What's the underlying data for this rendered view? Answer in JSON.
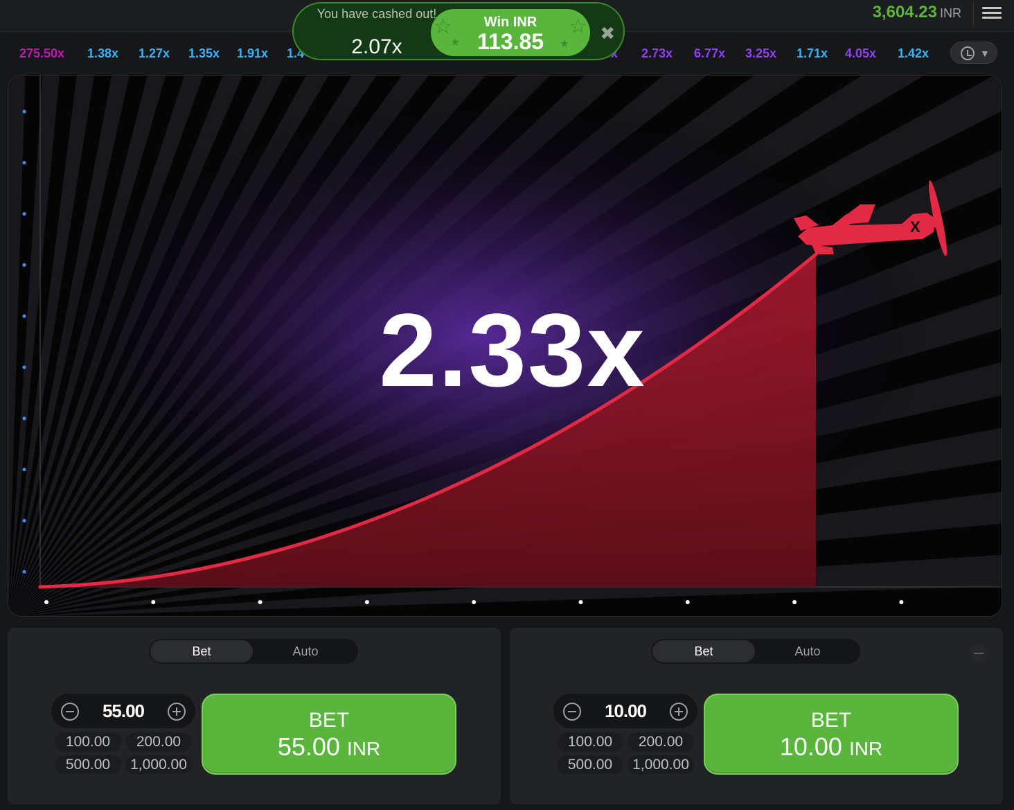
{
  "topbar": {
    "balance": "3,604.23",
    "currency": "INR"
  },
  "history": [
    {
      "value": "275.50x",
      "color": "#c017b4"
    },
    {
      "value": "1.38x",
      "color": "#34b4ff"
    },
    {
      "value": "1.27x",
      "color": "#34b4ff"
    },
    {
      "value": "1.35x",
      "color": "#34b4ff"
    },
    {
      "value": "1.91x",
      "color": "#34b4ff"
    },
    {
      "value": "1.4",
      "color": "#34b4ff"
    },
    {
      "value": "x",
      "color": "#913ef8"
    },
    {
      "value": "2.73x",
      "color": "#913ef8"
    },
    {
      "value": "6.77x",
      "color": "#913ef8"
    },
    {
      "value": "3.25x",
      "color": "#913ef8"
    },
    {
      "value": "1.71x",
      "color": "#34b4ff"
    },
    {
      "value": "4.05x",
      "color": "#913ef8"
    },
    {
      "value": "1.42x",
      "color": "#34b4ff"
    }
  ],
  "toast": {
    "message": "You have cashed out!",
    "multiplier": "2.07x",
    "win_label": "Win INR",
    "win_amount": "113.85"
  },
  "game": {
    "multiplier": "2.33x",
    "curve_color": "#e32a45",
    "plane_color": "#e32a45"
  },
  "panels": [
    {
      "tabs": [
        "Bet",
        "Auto"
      ],
      "amount": "55.00",
      "quick": [
        "100.00",
        "200.00",
        "500.00",
        "1,000.00"
      ],
      "bet_label": "BET",
      "bet_amount": "55.00",
      "bet_currency": "INR"
    },
    {
      "tabs": [
        "Bet",
        "Auto"
      ],
      "amount": "10.00",
      "quick": [
        "100.00",
        "200.00",
        "500.00",
        "1,000.00"
      ],
      "bet_label": "BET",
      "bet_amount": "10.00",
      "bet_currency": "INR"
    }
  ]
}
